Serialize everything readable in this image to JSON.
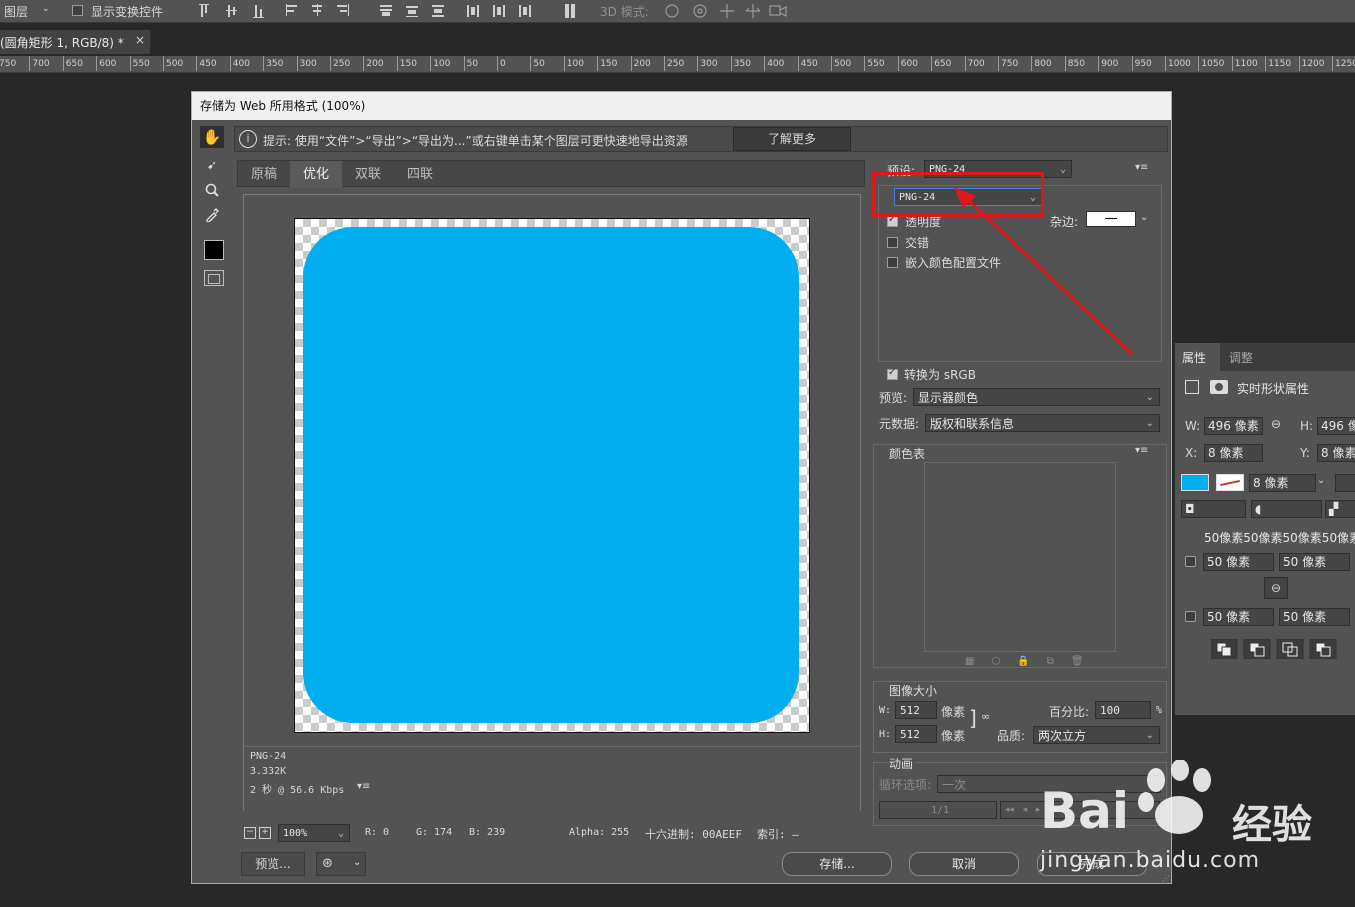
{
  "toolbar": {
    "layer_select": "图层",
    "show_transform": "显示变换控件",
    "mode_3d": "3D 模式:"
  },
  "document_tab": {
    "title": "(圆角矩形 1, RGB/8) *",
    "close": "×"
  },
  "ruler_ticks": [
    "750",
    "700",
    "650",
    "600",
    "550",
    "500",
    "450",
    "400",
    "350",
    "300",
    "250",
    "200",
    "150",
    "100",
    "50",
    "0",
    "50",
    "100",
    "150",
    "200",
    "250",
    "300",
    "350",
    "400",
    "450",
    "500",
    "550",
    "600",
    "650",
    "700",
    "750",
    "800",
    "850",
    "900",
    "950",
    "1000",
    "1050",
    "1100",
    "1150",
    "1200",
    "1250"
  ],
  "properties": {
    "tab_properties": "属性",
    "tab_adjust": "调整",
    "live_shape": "实时形状属性",
    "w_label": "W:",
    "w_value": "496 像素",
    "h_label": "H:",
    "h_value": "496 像",
    "x_label": "X:",
    "x_value": "8 像素",
    "y_label": "Y:",
    "y_value": "8 像素",
    "stroke_value": "8 像素",
    "corner_all": "50像素50像素50像素50像素",
    "c1": "50 像素",
    "c2": "50 像素",
    "c3": "50 像素",
    "c4": "50 像素",
    "fill_color": "#00AEEF"
  },
  "dialog": {
    "title": "存储为 Web 所用格式 (100%)",
    "hint": "提示: 使用“文件”>“导出”>“导出为...”或右键单击某个图层可更快速地导出资源",
    "learn_more": "了解更多",
    "tabs": [
      "原稿",
      "优化",
      "双联",
      "四联"
    ],
    "image_color": "#00AEEF",
    "info_format": "PNG-24",
    "info_size": "3.332K",
    "info_time": "2 秒 @ 56.6 Kbps",
    "zoom": "100%",
    "readout": {
      "r": "R: 0",
      "g": "G: 174",
      "b": "B: 239",
      "alpha": "Alpha: 255",
      "hex": "十六进制: 00AEEF",
      "index": "索引: —"
    },
    "preview_button": "预览...",
    "save_button": "存储...",
    "cancel_button": "取消",
    "done_button": "完成",
    "settings": {
      "preset_label": "预设:",
      "preset_value": "PNG-24",
      "format_value": "PNG-24",
      "transparency": "透明度",
      "matte_label": "杂边:",
      "interlaced": "交错",
      "embed_profile": "嵌入颜色配置文件",
      "convert_srgb": "转换为 sRGB",
      "preview_label": "预览:",
      "preview_value": "显示器颜色",
      "metadata_label": "元数据:",
      "metadata_value": "版权和联系信息",
      "color_table": "颜色表",
      "image_size": "图像大小",
      "w_label": "W:",
      "w_value": "512",
      "px1": "像素",
      "h_label": "H:",
      "h_value": "512",
      "px2": "像素",
      "percent_label": "百分比:",
      "percent_value": "100",
      "percent_unit": "%",
      "quality_label": "品质:",
      "quality_value": "两次立方",
      "animation": "动画",
      "loop_label": "循环选项:",
      "loop_value": "一次",
      "frame": "1/1"
    }
  },
  "watermark": {
    "brand": "Bai",
    "brand_cn": "经验",
    "url": "jingyan.baidu.com"
  }
}
